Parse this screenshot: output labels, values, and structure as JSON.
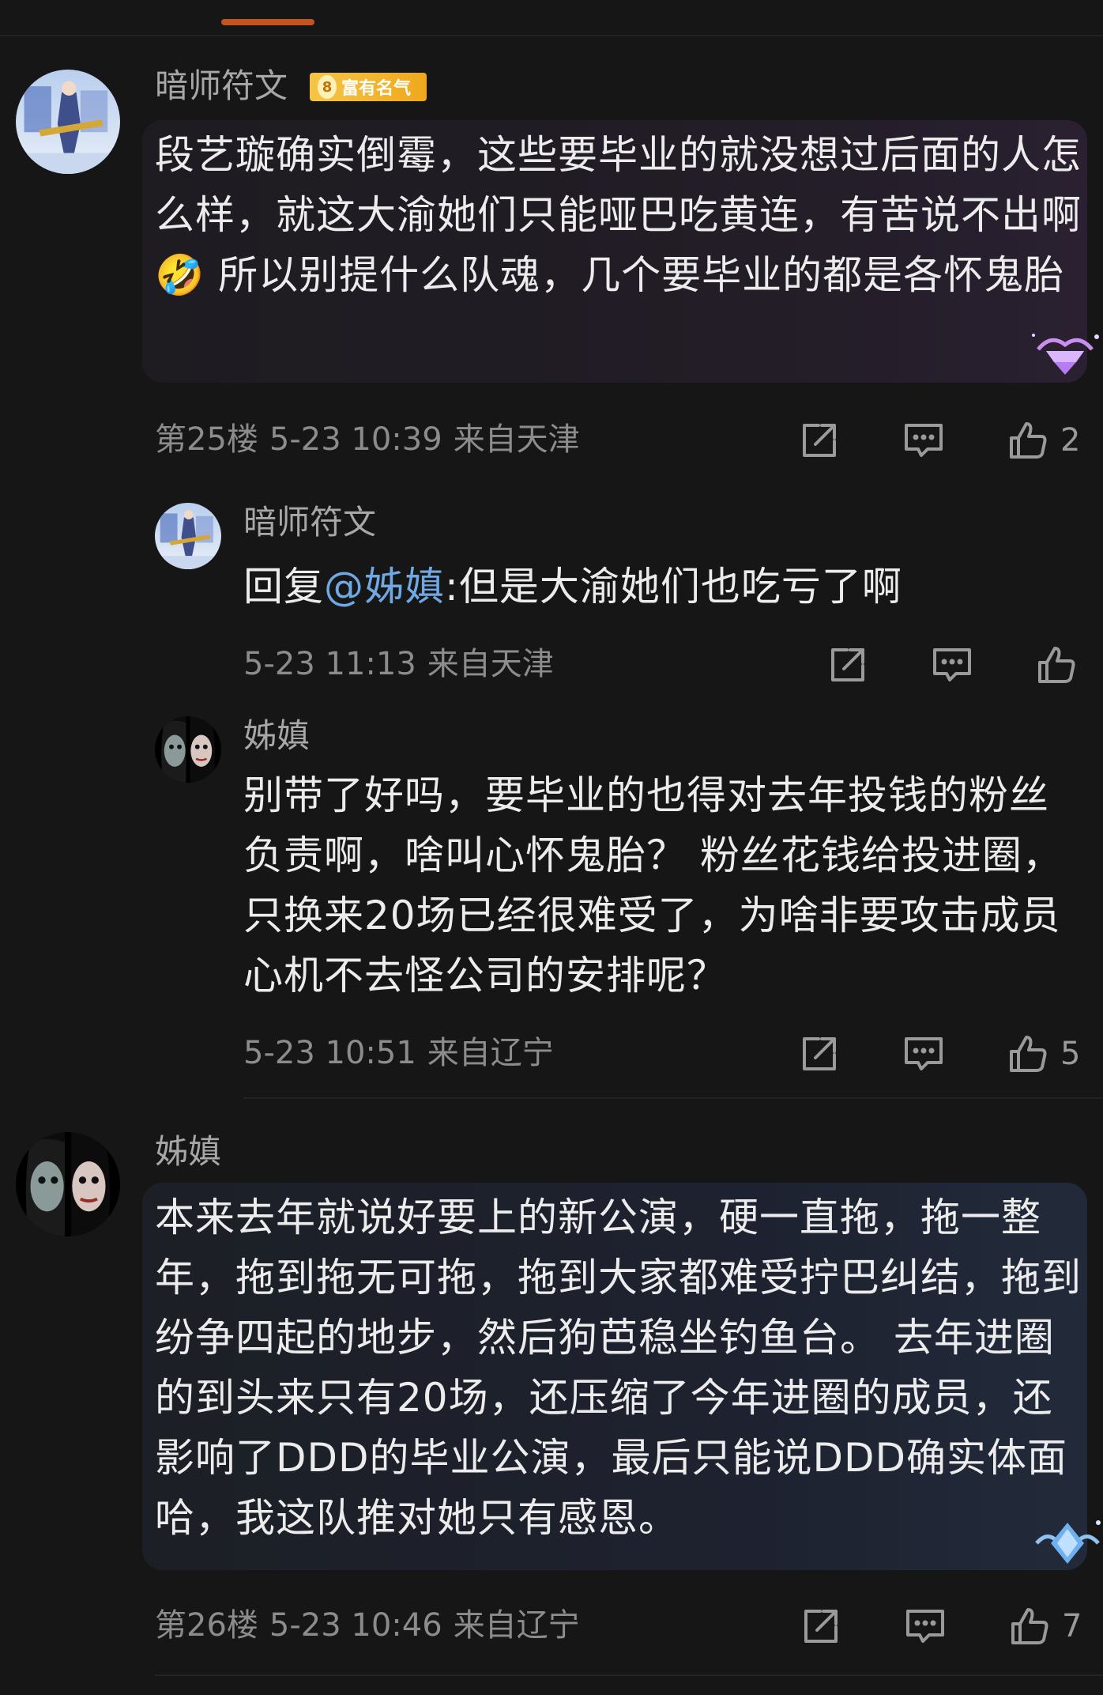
{
  "comments": [
    {
      "user": "暗师符文",
      "badge": {
        "level": "8",
        "label": "富有名气"
      },
      "text": "段艺璇确实倒霉，这些要毕业的就没想过后面的人怎么样，就这大渝她们只能哑巴吃黄连，有苦说不出啊🤣 所以别提什么队魂，几个要毕业的都是各怀鬼胎",
      "floor": "第25楼",
      "time": "5-23 10:39",
      "location": "来自天津",
      "likes": "2",
      "replies": [
        {
          "user": "暗师符文",
          "reply_prefix": "回复",
          "mention": "@姊嫃",
          "text": ":但是大渝她们也吃亏了啊",
          "time": "5-23 11:13",
          "location": "来自天津",
          "likes": ""
        },
        {
          "user": "姊嫃",
          "text": "别带了好吗，要毕业的也得对去年投钱的粉丝负责啊，啥叫心怀鬼胎？ 粉丝花钱给投进圈，只换来20场已经很难受了，为啥非要攻击成员心机不去怪公司的安排呢？",
          "time": "5-23 10:51",
          "location": "来自辽宁",
          "likes": "5"
        }
      ]
    },
    {
      "user": "姊嫃",
      "text": "本来去年就说好要上的新公演，硬一直拖，拖一整年，拖到拖无可拖，拖到大家都难受拧巴纠结，拖到纷争四起的地步，然后狗芭稳坐钓鱼台。 去年进圈的到头来只有20场，还压缩了今年进圈的成员，还影响了DDD的毕业公演，最后只能说DDD确实体面哈，我这队推对她只有感恩。",
      "floor": "第26楼",
      "time": "5-23 10:46",
      "location": "来自辽宁",
      "likes": "7"
    }
  ],
  "icons": {
    "share": "share-icon",
    "comment": "comment-icon",
    "like": "thumbs-up-icon"
  },
  "colors": {
    "background": "#161616",
    "mention": "#6fa8e3",
    "accent": "#c2551f",
    "badge": "#f0a81c"
  }
}
